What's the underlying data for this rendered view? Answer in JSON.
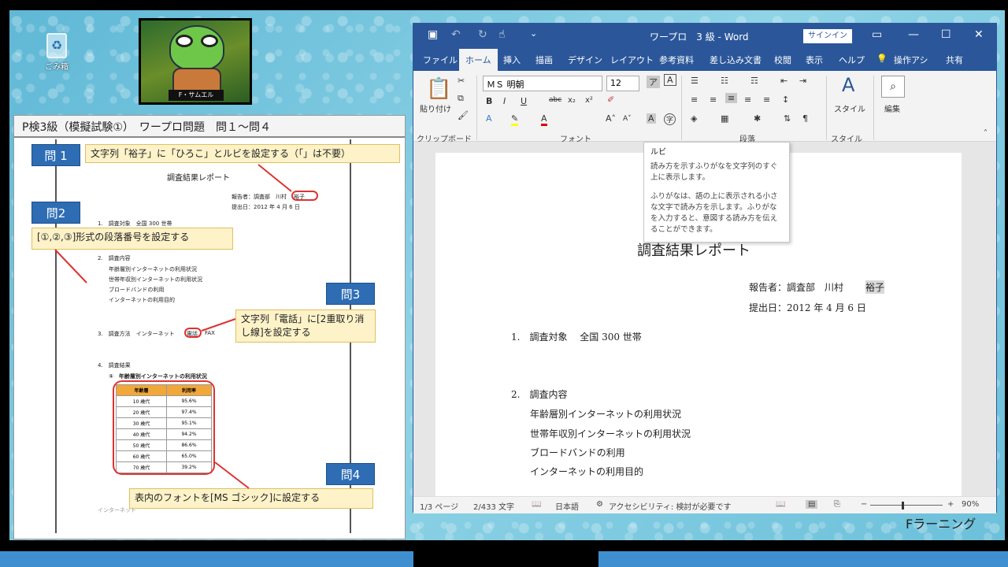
{
  "desktop": {
    "recycle_label": "ごみ箱",
    "recycle_icon": "recycle-icon",
    "brand": "Fラーニング"
  },
  "avatar": {
    "name": "F・サムエル"
  },
  "exam": {
    "title": "P検3級（模擬試験①）　ワープロ問題　問１～問４",
    "q1": {
      "label": "問 1",
      "text": "文字列「裕子」に「ひろこ」とルビを設定する（「」は不要）"
    },
    "q2": {
      "label": "問2",
      "text": "[①,②,③]形式の段落番号を設定する"
    },
    "q3": {
      "label": "問3",
      "text": "文字列「電話」に[2重取り消し線]を設定する"
    },
    "q4": {
      "label": "問4",
      "text": "表内のフォントを[MS ゴシック]に設定する"
    },
    "preview": {
      "title": "調査結果レポート",
      "reporter": "報告者：調査部　川村",
      "reporter_name": "裕子",
      "date": "提出日：2012 年 4 月 6 日",
      "items": [
        "1.　調査対象　全国 300 世帯",
        "2.　調査内容",
        "年齢層別インターネットの利用状況",
        "世帯年収別インターネットの利用状況",
        "ブロードバンドの利用",
        "インターネットの利用目的",
        "3.　調査方法　インターネット",
        "電話",
        "FAX",
        "4.　調査結果",
        "①　年齢層別インターネットの利用状況",
        "インターネット"
      ],
      "table": {
        "headers": [
          "年齢層",
          "利用率"
        ],
        "rows": [
          [
            "10 歳代",
            "95.6%"
          ],
          [
            "20 歳代",
            "97.4%"
          ],
          [
            "30 歳代",
            "95.1%"
          ],
          [
            "40 歳代",
            "94.2%"
          ],
          [
            "50 歳代",
            "86.6%"
          ],
          [
            "60 歳代",
            "65.0%"
          ],
          [
            "70 歳代",
            "39.2%"
          ]
        ]
      }
    }
  },
  "word": {
    "title": "ワープロ　3 級  -  Word",
    "signin": "サインイン",
    "tabs": [
      "ファイル",
      "ホーム",
      "挿入",
      "描画",
      "デザイン",
      "レイアウト",
      "参考資料",
      "差し込み文書",
      "校閲",
      "表示",
      "ヘルプ",
      "操作アシ",
      "共有"
    ],
    "font_name": "ＭＳ 明朝",
    "font_size": "12",
    "groups": {
      "clipboard": "クリップボード",
      "font": "フォント",
      "paragraph": "段落",
      "style": "スタイル"
    },
    "paste": "貼り付け",
    "style_btn": "スタイル",
    "edit_btn": "編集",
    "tooltip": {
      "title": "ルビ",
      "line1": "読み方を示すふりがなを文字列のすぐ上に表示します。",
      "line2": "ふりがなは、語の上に表示される小さな文字で読み方を示します。ふりがなを入力すると、意図する読み方を伝えることができます。"
    },
    "doc": {
      "title": "調査結果レポート",
      "reporter": "報告者：調査部　川村",
      "reporter_name": "裕子",
      "date": "提出日：2012 年 4 月 6 日",
      "lines": [
        "1.　調査対象　 全国 300 世帯",
        "2.　調査内容",
        "年齢層別インターネットの利用状況",
        "世帯年収別インターネットの利用状況",
        "ブロードバンドの利用",
        "インターネットの利用目的"
      ]
    },
    "status": {
      "page": "1/3 ページ",
      "words": "2/433 文字",
      "lang": "日本語",
      "access": "アクセシビリティ: 検討が必要です",
      "zoom": "90%"
    }
  }
}
